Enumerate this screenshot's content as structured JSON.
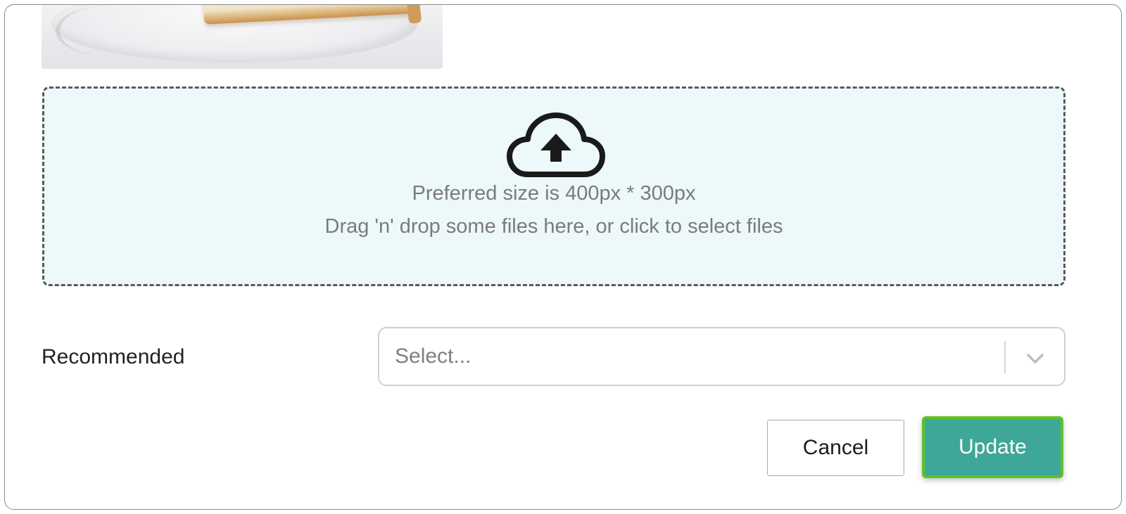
{
  "preview": {
    "image_name": "uploaded-cake-photo"
  },
  "dropzone": {
    "icon": "cloud-upload-icon",
    "line1": "Preferred size is 400px * 300px",
    "line2": "Drag 'n' drop some files here, or click to select files"
  },
  "recommended": {
    "label": "Recommended",
    "select_placeholder": "Select...",
    "dropdown_icon": "chevron-down-icon"
  },
  "actions": {
    "cancel_label": "Cancel",
    "update_label": "Update"
  },
  "colors": {
    "dropzone_bg": "#edf8fb",
    "update_bg": "#3fa797",
    "update_focus_ring": "#5ec12a"
  }
}
